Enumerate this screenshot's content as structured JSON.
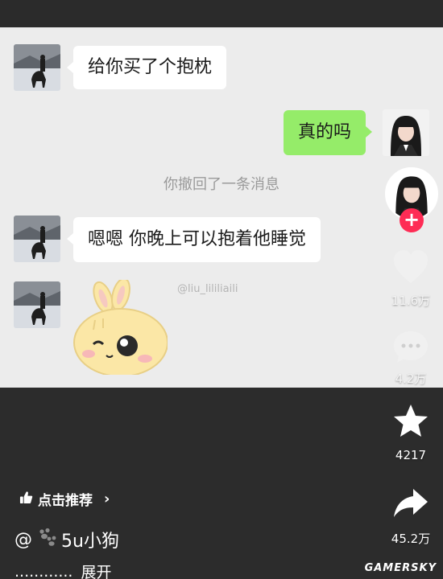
{
  "chat": {
    "messages": [
      {
        "side": "left",
        "text": "给你买了个抱枕"
      },
      {
        "side": "right",
        "text": "真的吗"
      },
      {
        "side": "left",
        "text": "嗯嗯 你晚上可以抱着他睡觉"
      }
    ],
    "system_notice": "你撤回了一条消息",
    "watermark": "@liu_lililiaili"
  },
  "sidebar": {
    "follow_label": "+",
    "like_count": "11.6万",
    "comment_count": "4.2万",
    "favorite_count": "4217",
    "share_count": "45.2万"
  },
  "footer": {
    "recommend_label": "点击推荐",
    "author": "5u小狗",
    "author_prefix": "@",
    "caption_dots": "............",
    "expand_label": "展开",
    "logo": "GAMERSKY"
  },
  "colors": {
    "chat_bg": "#ececec",
    "green_bubble": "#95ec69",
    "follow_red": "#fe2c55"
  }
}
